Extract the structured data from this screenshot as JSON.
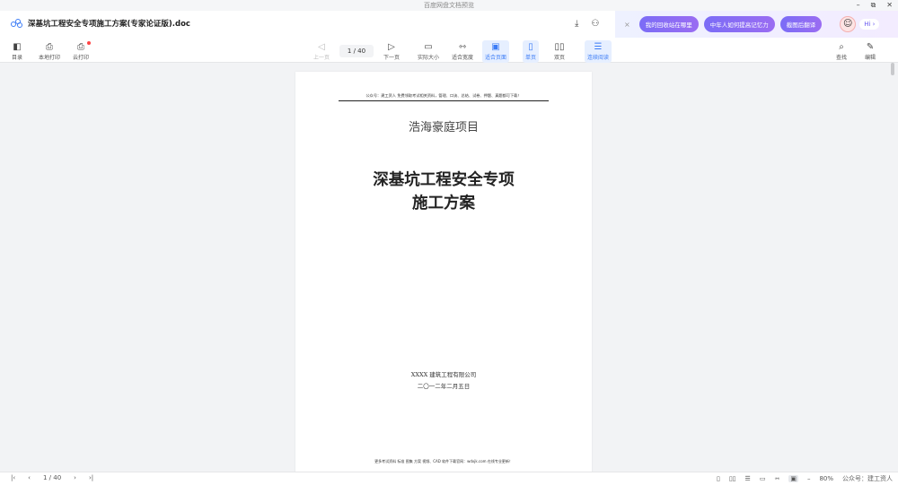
{
  "window": {
    "title": "百度网盘文档预览",
    "minimize": "–",
    "restore": "⧉",
    "close": "✕"
  },
  "header": {
    "doc_title": "深基坑工程安全专项施工方案(专家论证版).doc",
    "download_icon": "download-icon",
    "share_icon": "share-icon",
    "ai_close": "×",
    "ai_pills": [
      "我的回收站在哪里",
      "中年人如何提高记忆力",
      "截图后翻译"
    ],
    "ai_greeting": "Hi ›"
  },
  "toolbar": {
    "toc": "目录",
    "local_print": "本地打印",
    "cloud_print": "云打印",
    "prev_page": "上一页",
    "page_indicator": "1 / 40",
    "next_page": "下一页",
    "actual_size": "实际大小",
    "fit_width": "适合宽度",
    "fit_page": "适合页面",
    "single_page": "单页",
    "double_page": "双页",
    "continuous": "连续阅读",
    "search": "查找",
    "edit": "编辑"
  },
  "document": {
    "header_line": "公众号：建工资人 免费领取考试相关资料，管理、口诀、总结、试卷、押题、真题都可下载！",
    "project": "浩海豪庭项目",
    "title_line1": "深基坑工程安全专项",
    "title_line2": "施工方案",
    "company": "XXXX 建筑工程有限公司",
    "date": "二〇一二年二月五日",
    "footer_line": "更多考试资料 标准 图集 方案 视频、CAD 软件下载官网：wdxjk.com 在线专业更新！"
  },
  "statusbar": {
    "page_indicator": "1 / 40",
    "zoom": "80%",
    "watermark": "公众号：建工资人"
  }
}
